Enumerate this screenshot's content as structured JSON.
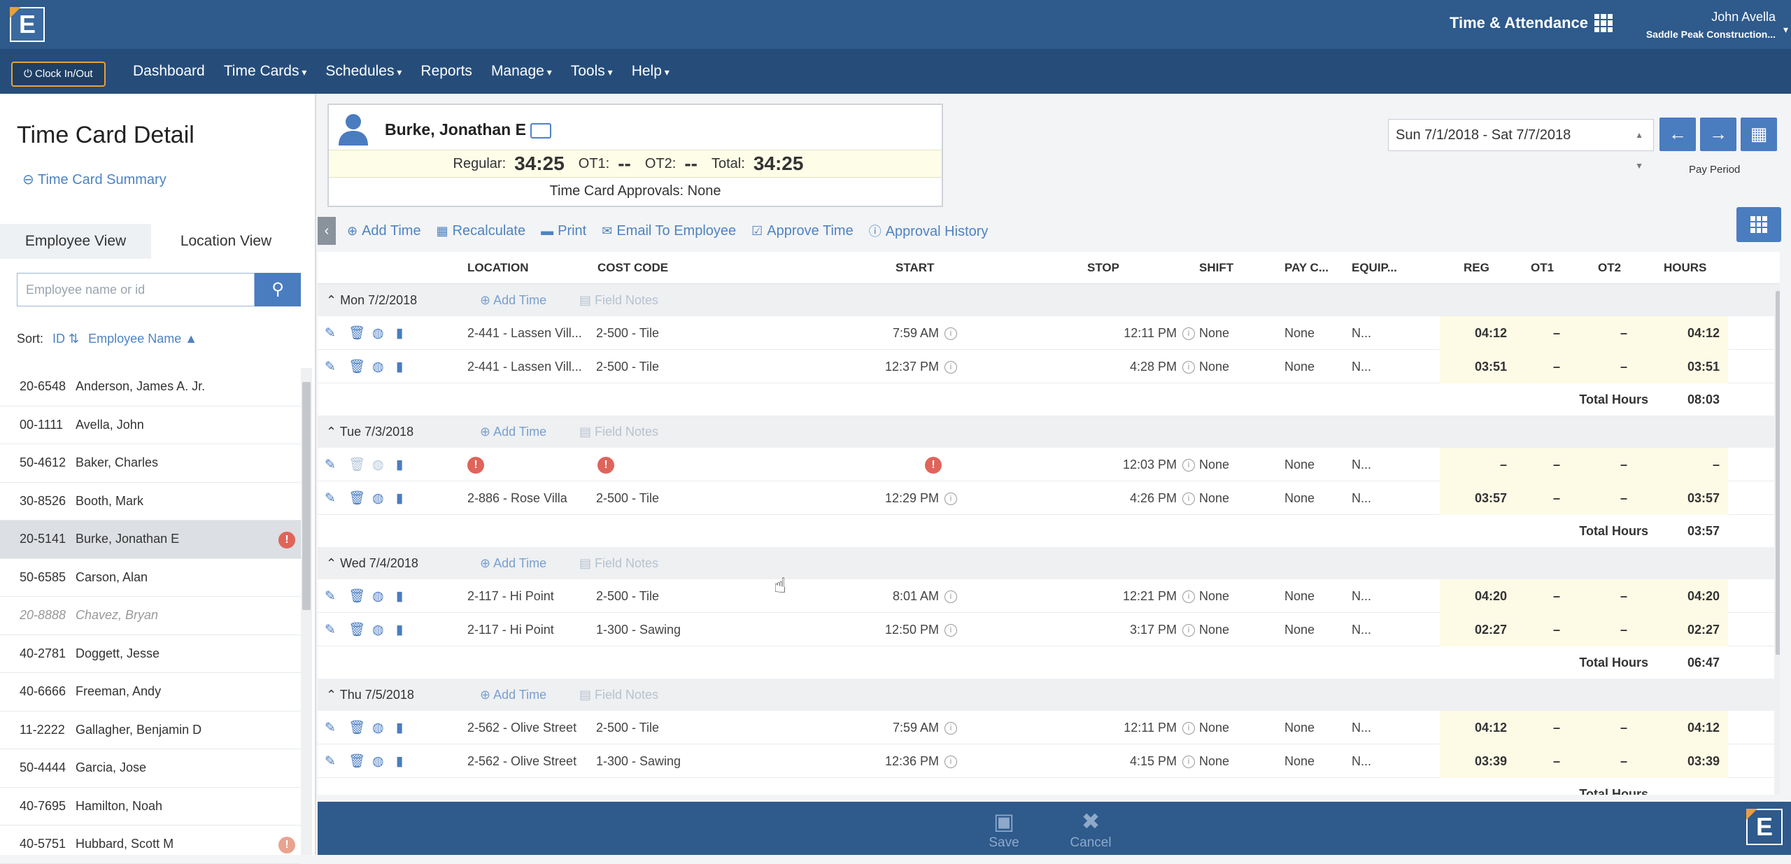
{
  "header": {
    "logo": "E",
    "app_name": "Time & Attendance",
    "user_name": "John Avella",
    "company": "Saddle Peak Construction..."
  },
  "nav": {
    "clock_button": "Clock In/Out",
    "items": [
      "Dashboard",
      "Time Cards",
      "Schedules",
      "Reports",
      "Manage",
      "Tools",
      "Help"
    ]
  },
  "sidebar": {
    "title": "Time Card Detail",
    "summary_link": "Time Card Summary",
    "tabs": [
      "Employee View",
      "Location View"
    ],
    "search_placeholder": "Employee name or id",
    "sort_label": "Sort:",
    "sort_id": "ID",
    "sort_name": "Employee Name",
    "employees": [
      {
        "id": "20-6548",
        "name": "Anderson, James A. Jr."
      },
      {
        "id": "00-1111",
        "name": "Avella, John"
      },
      {
        "id": "50-4612",
        "name": "Baker, Charles"
      },
      {
        "id": "30-8526",
        "name": "Booth, Mark"
      },
      {
        "id": "20-5141",
        "name": "Burke, Jonathan E"
      },
      {
        "id": "50-6585",
        "name": "Carson, Alan"
      },
      {
        "id": "20-8888",
        "name": "Chavez, Bryan"
      },
      {
        "id": "40-2781",
        "name": "Doggett, Jesse"
      },
      {
        "id": "40-6666",
        "name": "Freeman, Andy"
      },
      {
        "id": "11-2222",
        "name": "Gallagher, Benjamin D"
      },
      {
        "id": "50-4444",
        "name": "Garcia, Jose"
      },
      {
        "id": "40-7695",
        "name": "Hamilton, Noah"
      },
      {
        "id": "40-5751",
        "name": "Hubbard, Scott M"
      }
    ]
  },
  "card": {
    "employee": "Burke, Jonathan E",
    "regular_label": "Regular:",
    "regular": "34:25",
    "ot1_label": "OT1:",
    "ot1": "--",
    "ot2_label": "OT2:",
    "ot2": "--",
    "total_label": "Total:",
    "total": "34:25",
    "approvals": "Time Card Approvals: None"
  },
  "period": {
    "value": "Sun 7/1/2018 - Sat 7/7/2018",
    "label": "Pay Period"
  },
  "toolbar": [
    "Add Time",
    "Recalculate",
    "Print",
    "Email To Employee",
    "Approve Time",
    "Approval History"
  ],
  "columns": {
    "location": "LOCATION",
    "cost_code": "COST CODE",
    "start": "START",
    "stop": "STOP",
    "shift": "SHIFT",
    "pay": "PAY C...",
    "equip": "EQUIP...",
    "reg": "REG",
    "ot1": "OT1",
    "ot2": "OT2",
    "hours": "HOURS"
  },
  "day_actions": {
    "add_time": "Add Time",
    "field_notes": "Field Notes"
  },
  "total_hours_label": "Total Hours",
  "days": [
    {
      "label": "Mon 7/2/2018",
      "total": "08:03",
      "rows": [
        {
          "location": "2-441 - Lassen Vill...",
          "cost": "2-500 - Tile",
          "start": "7:59 AM",
          "stop": "12:11 PM",
          "shift": "None",
          "pay": "None",
          "equip": "N...",
          "reg": "04:12",
          "ot1": "–",
          "ot2": "–",
          "hours": "04:12"
        },
        {
          "location": "2-441 - Lassen Vill...",
          "cost": "2-500 - Tile",
          "start": "12:37 PM",
          "stop": "4:28 PM",
          "shift": "None",
          "pay": "None",
          "equip": "N...",
          "reg": "03:51",
          "ot1": "–",
          "ot2": "–",
          "hours": "03:51"
        }
      ]
    },
    {
      "label": "Tue 7/3/2018",
      "total": "03:57",
      "rows": [
        {
          "location": "",
          "cost": "",
          "start": "",
          "stop": "12:03 PM",
          "shift": "None",
          "pay": "None",
          "equip": "N...",
          "reg": "–",
          "ot1": "–",
          "ot2": "–",
          "hours": "–",
          "error": true
        },
        {
          "location": "2-886 - Rose Villa",
          "cost": "2-500 - Tile",
          "start": "12:29 PM",
          "stop": "4:26 PM",
          "shift": "None",
          "pay": "None",
          "equip": "N...",
          "reg": "03:57",
          "ot1": "–",
          "ot2": "–",
          "hours": "03:57"
        }
      ]
    },
    {
      "label": "Wed 7/4/2018",
      "total": "06:47",
      "rows": [
        {
          "location": "2-117 - Hi Point",
          "cost": "2-500 - Tile",
          "start": "8:01 AM",
          "stop": "12:21 PM",
          "shift": "None",
          "pay": "None",
          "equip": "N...",
          "reg": "04:20",
          "ot1": "–",
          "ot2": "–",
          "hours": "04:20"
        },
        {
          "location": "2-117 - Hi Point",
          "cost": "1-300 - Sawing",
          "start": "12:50 PM",
          "stop": "3:17 PM",
          "shift": "None",
          "pay": "None",
          "equip": "N...",
          "reg": "02:27",
          "ot1": "–",
          "ot2": "–",
          "hours": "02:27"
        }
      ]
    },
    {
      "label": "Thu 7/5/2018",
      "total": "",
      "rows": [
        {
          "location": "2-562 - Olive Street",
          "cost": "2-500 - Tile",
          "start": "7:59 AM",
          "stop": "12:11 PM",
          "shift": "None",
          "pay": "None",
          "equip": "N...",
          "reg": "04:12",
          "ot1": "–",
          "ot2": "–",
          "hours": "04:12"
        },
        {
          "location": "2-562 - Olive Street",
          "cost": "1-300 - Sawing",
          "start": "12:36 PM",
          "stop": "4:15 PM",
          "shift": "None",
          "pay": "None",
          "equip": "N...",
          "reg": "03:39",
          "ot1": "–",
          "ot2": "–",
          "hours": "03:39"
        }
      ]
    }
  ],
  "footer": {
    "save": "Save",
    "cancel": "Cancel",
    "logo": "E"
  }
}
